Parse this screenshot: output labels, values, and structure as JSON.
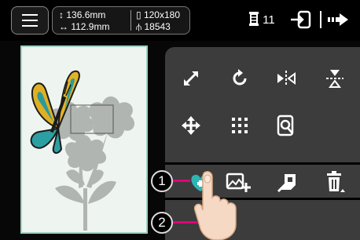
{
  "status_bar": {
    "height": "136.6mm",
    "width": "112.9mm",
    "frame_size": "120x180",
    "stitch_count": "18543",
    "thread_count": "11"
  },
  "callouts": [
    "1",
    "2"
  ],
  "icons": {
    "menu": "menu-icon",
    "height": "height-arrow-icon",
    "width": "width-arrow-icon",
    "frame": "frame-icon",
    "stitches": "stitch-count-icon",
    "spool": "thread-spool-icon",
    "exit": "exit-icon",
    "next": "next-icon",
    "size": "resize-icon",
    "rotate": "rotate-icon",
    "mirror_h": "mirror-horizontal-icon",
    "mirror_v": "mirror-vertical-icon",
    "move": "move-icon",
    "density": "density-icon",
    "zoom": "zoom-icon",
    "color_change": "color-palette-icon",
    "add": "add-pattern-icon",
    "border": "border-icon",
    "delete": "delete-icon",
    "sewing": "sewing-machine-icon",
    "hand": "touch-hand-icon"
  },
  "colors": {
    "callout_line": "#e2007a",
    "panel": "#3c3c3c",
    "preview_bg": "#eef4ef",
    "preview_border": "#9fcfc3"
  }
}
